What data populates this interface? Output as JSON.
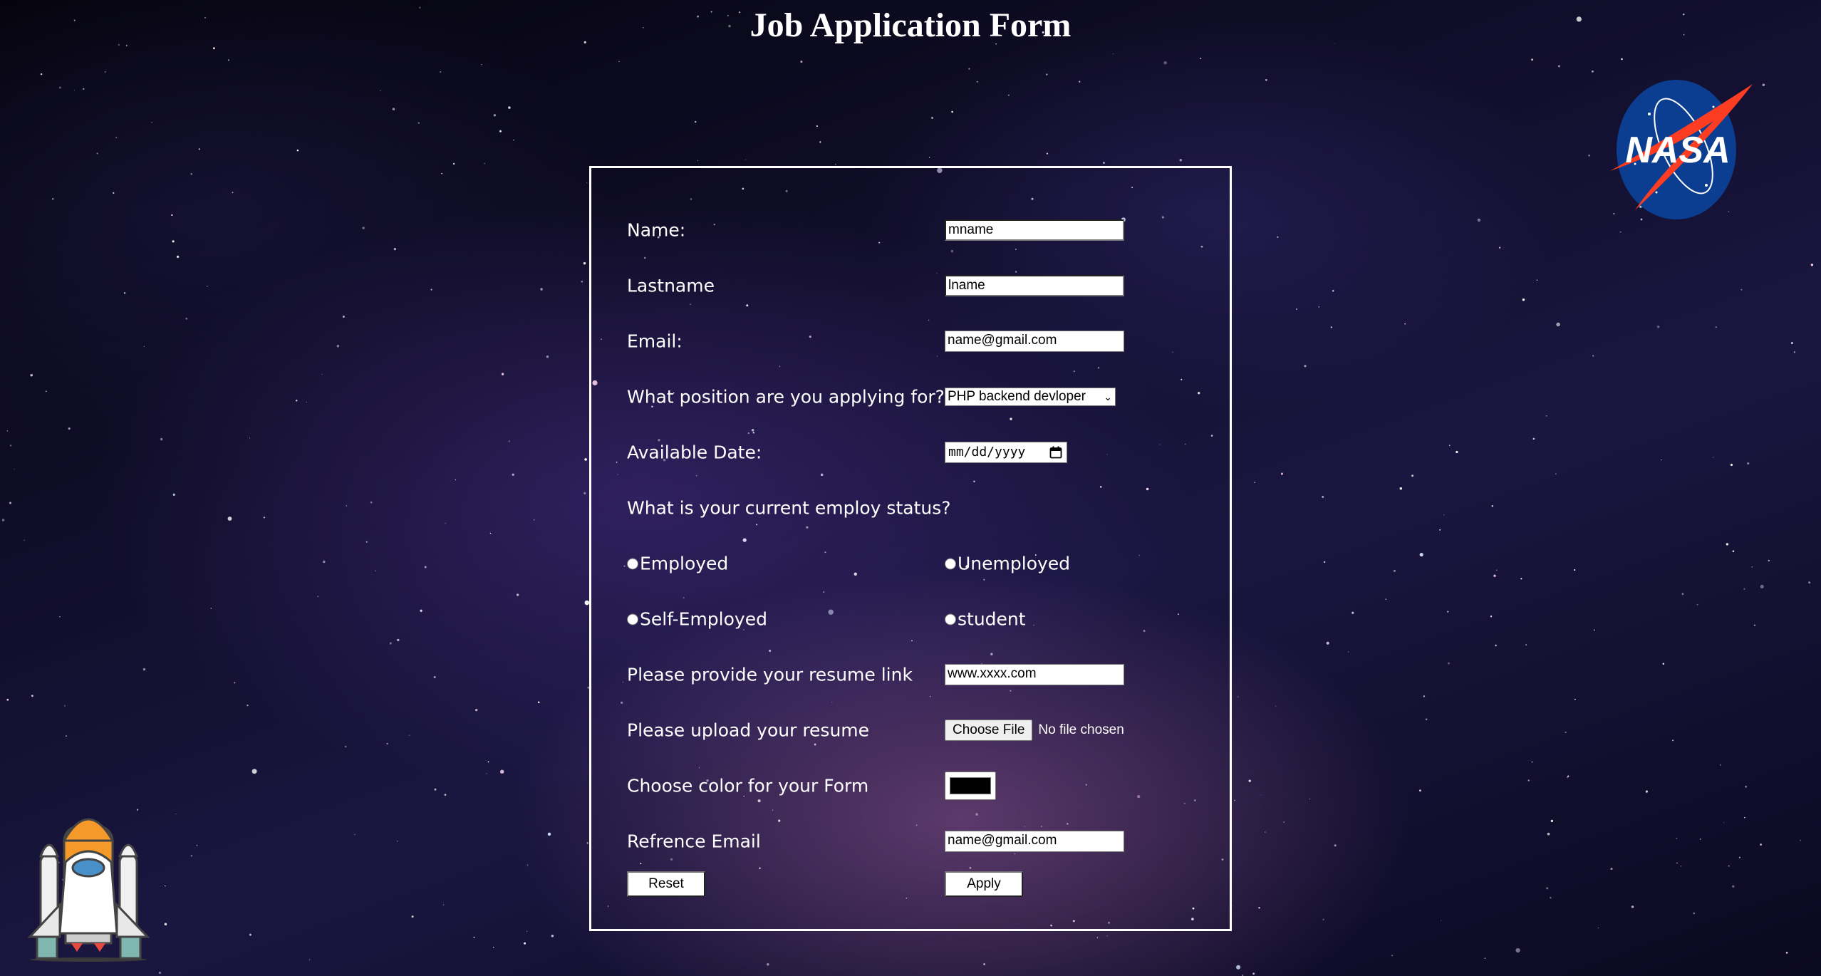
{
  "page": {
    "title": "Job Application Form",
    "background_colors": [
      "#05040d",
      "#1a1640",
      "#965a96"
    ],
    "logo_text": "NASA"
  },
  "form": {
    "border_color": "#ffffff",
    "fields": {
      "name": {
        "label": "Name:",
        "value": "mname"
      },
      "lastname": {
        "label": "Lastname",
        "value": "lname"
      },
      "email": {
        "label": "Email:",
        "value": "name@gmail.com"
      },
      "position": {
        "label": "What position are you applying for?",
        "selected": "PHP backend devloper"
      },
      "available_date": {
        "label": "Available Date:",
        "placeholder": "mm/dd/yyyy"
      },
      "employ_status": {
        "label": "What is your current employ status?",
        "options": [
          "Employed",
          "Unemployed",
          "Self-Employed",
          "student"
        ]
      },
      "resume_link": {
        "label": "Please provide your resume link",
        "value": "www.xxxx.com"
      },
      "resume_upload": {
        "label": "Please upload your resume",
        "button": "Choose File",
        "status": "No file chosen"
      },
      "form_color": {
        "label": "Choose color for your Form",
        "value": "#000000"
      },
      "reference_email": {
        "label": "Refrence Email",
        "value": "name@gmail.com"
      }
    },
    "buttons": {
      "reset": "Reset",
      "apply": "Apply"
    }
  },
  "icons": {
    "logo": "nasa-logo-icon",
    "decoration": "space-shuttle-icon",
    "select_chevron": "chevron-down-icon",
    "date_picker": "calendar-icon"
  }
}
